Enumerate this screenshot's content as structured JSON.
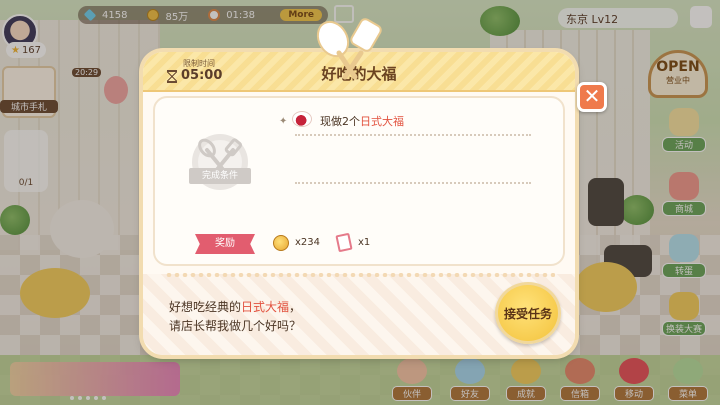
{
  "hud": {
    "gems": "4158",
    "coins": "85万",
    "time": "01:38",
    "more_label": "More",
    "level_count": "167",
    "city_label": "东京 Lv12",
    "city_book_label": "城市手札",
    "side_progress": "0/1",
    "badge_time": "20:29"
  },
  "right_panel": {
    "open_big": "OPEN",
    "open_small": "营业中",
    "buttons": [
      {
        "label": "活动"
      },
      {
        "label": "商城"
      },
      {
        "label": "转蛋"
      },
      {
        "label": "换装大赛"
      }
    ]
  },
  "bottom_bar": [
    {
      "label": "伙伴"
    },
    {
      "label": "好友"
    },
    {
      "label": "成就"
    },
    {
      "label": "信箱"
    },
    {
      "label": "移动"
    },
    {
      "label": "菜单"
    }
  ],
  "modal": {
    "timer_label": "限制时间",
    "timer_value": "05:00",
    "title": "好吃的大福",
    "condition_label": "完成条件",
    "task": {
      "prefix": "现做2个",
      "item": "日式大福"
    },
    "reward_label": "奖励",
    "rewards": [
      {
        "icon": "coin-icon",
        "value": "x234"
      },
      {
        "icon": "ticket-icon",
        "value": "x1"
      }
    ],
    "dialog": {
      "line1_prefix": "好想吃经典的",
      "line1_item": "日式大福",
      "line1_suffix": "，",
      "line2": "请店长帮我做几个好吗？"
    },
    "accept_label": "接受任务",
    "close_symbol": "✕"
  },
  "colors": {
    "accent": "#e2523f",
    "header": "#fbe7a8",
    "close": "#ef7a4c",
    "accept": "#f3c23b",
    "reward_ribbon": "#e25d6f"
  }
}
